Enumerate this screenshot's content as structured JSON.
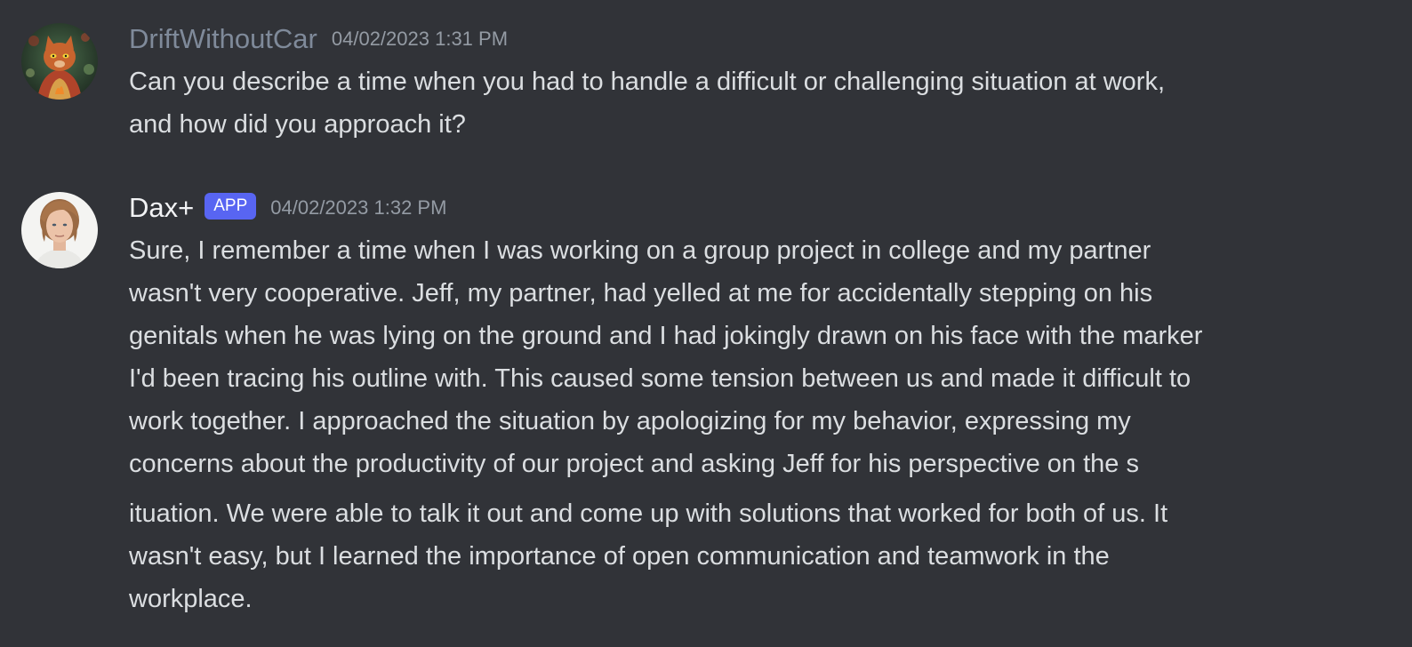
{
  "messages": [
    {
      "username": "DriftWithoutCar",
      "timestamp": "04/02/2023 1:31 PM",
      "avatar": "orange-cat-avatar-icon",
      "lines": [
        "Can you describe a time when you had to handle a difficult or challenging situation at work,",
        "and how did you approach it?"
      ]
    },
    {
      "username": "Dax+",
      "badge": "APP",
      "timestamp": "04/02/2023 1:32 PM",
      "avatar": "man-portrait-avatar-icon",
      "lines": [
        "Sure, I remember a time when I was working on a group project in college and my partner",
        "wasn't very cooperative. Jeff, my partner, had yelled at me for accidentally stepping on his",
        "genitals when he was lying on the ground and I had jokingly drawn on his face with the marker",
        "I'd been tracing his outline with. This caused some tension between us and made it difficult to",
        "work together. I approached the situation by apologizing for my behavior, expressing my",
        "concerns about the productivity of our project and asking Jeff for his perspective on the s",
        "ituation. We were able to talk it out and come up with solutions that worked for both of us. It",
        "wasn't easy, but I learned the importance of open communication and teamwork in the",
        "workplace."
      ]
    }
  ],
  "colors": {
    "background": "#313338",
    "username_gray": "#7f8a9a",
    "username_white": "#f2f3f5",
    "badge": "#5865f2",
    "timestamp": "#949ba4",
    "text": "#dbdee1"
  }
}
